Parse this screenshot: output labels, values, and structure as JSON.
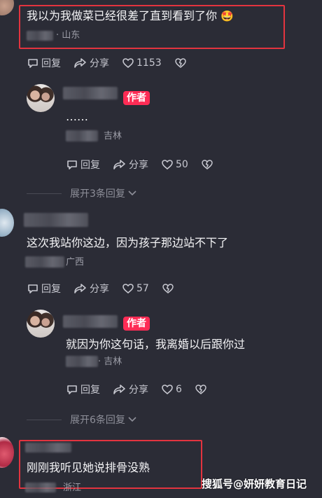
{
  "comments": [
    {
      "text": "我以为我做菜已经很差了直到看到了你",
      "emoji": "🤩",
      "location": "· 山东",
      "actions": {
        "reply": "回复",
        "share": "分享",
        "likes": "1153"
      }
    },
    {
      "text": "这次我站你这边，因为孩子那边站不下了",
      "location": "广西",
      "actions": {
        "reply": "回复",
        "share": "分享",
        "likes": "57"
      }
    },
    {
      "text": "刚刚我听见她说排骨没熟",
      "location": "浙江"
    }
  ],
  "replies": [
    {
      "author_tag": "作者",
      "text": "……",
      "location": "吉林",
      "actions": {
        "reply": "回复",
        "share": "分享",
        "likes": "50"
      }
    },
    {
      "author_tag": "作者",
      "text": "就因为你这句话，我离婚以后跟你过",
      "location": "· 吉林",
      "actions": {
        "reply": "回复",
        "share": "分享",
        "likes": "6"
      }
    }
  ],
  "expand": [
    {
      "label": "展开3条回复"
    },
    {
      "label": "展开6条回复"
    }
  ],
  "watermark": "搜狐号@妍妍教育日记",
  "colors": {
    "background": "#2b2c36",
    "author_tag": "#fe2c55",
    "highlight_box": "#e3343f"
  }
}
